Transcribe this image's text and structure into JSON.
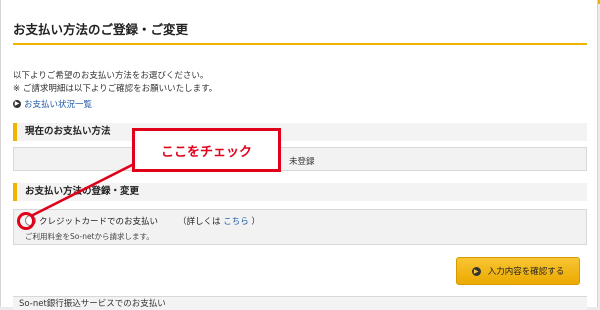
{
  "page": {
    "title": "お支払い方法のご登録・ご変更",
    "intro_line1": "以下よりご希望のお支払い方法をお選びください。",
    "intro_line2": "※ ご請求明細は以下よりご確認をお願いいたします。",
    "status_link": "お支払い状況一覧"
  },
  "current_method": {
    "header": "現在のお支払い方法",
    "value": "未登録"
  },
  "register": {
    "header": "お支払い方法の登録・変更",
    "credit_option_label": "クレジットカードでのお支払い",
    "detail_prefix": "（詳しくは",
    "detail_link": "こちら",
    "detail_suffix": "）",
    "credit_option_sub": "ご利用料金をSo-netから請求します。",
    "confirm_button": "入力内容を確認する",
    "next_section": "So-net銀行振込サービスでのお支払い"
  },
  "annotation": {
    "callout_text": "ここをチェック"
  },
  "colors": {
    "accent": "#f0b400",
    "link": "#1e5aa8",
    "annotation": "#e0001a",
    "button": "#f8c534"
  },
  "icons": {
    "link_arrow": "arrow-circle-icon",
    "button_arrow": "arrow-circle-icon"
  }
}
